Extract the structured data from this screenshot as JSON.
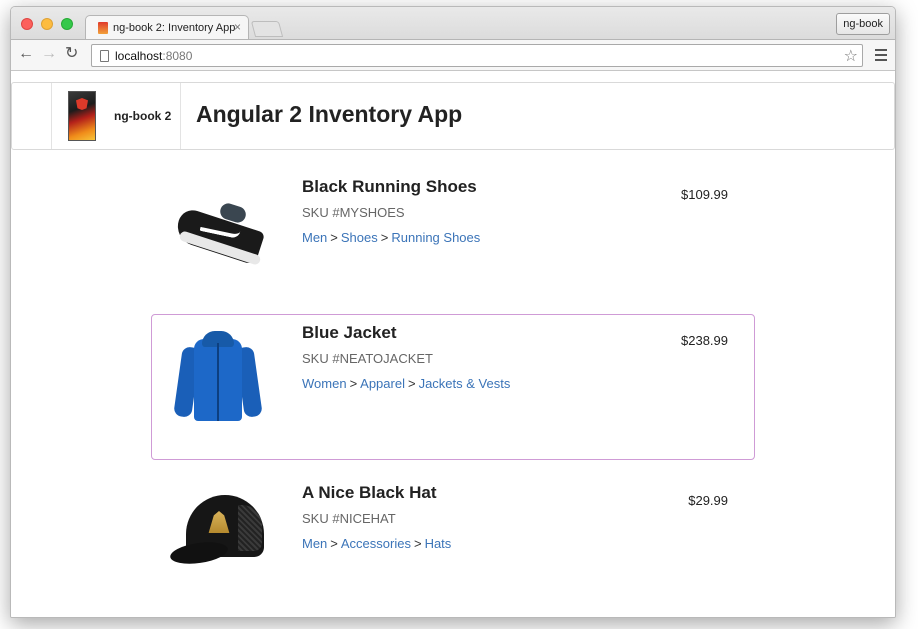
{
  "browser": {
    "tab_title": "ng-book 2: Inventory App",
    "tab_close": "×",
    "profile_button": "ng-book",
    "url_host": "localhost",
    "url_port": ":8080",
    "back_icon": "←",
    "forward_icon": "→",
    "reload_icon": "↻",
    "star_icon": "☆"
  },
  "header": {
    "brand": "ng-book 2",
    "title": "Angular 2 Inventory App"
  },
  "colors": {
    "link": "#3b74b8",
    "selected_border": "#cf9bd6"
  },
  "products": [
    {
      "name": "Black Running Shoes",
      "sku": "SKU #MYSHOES",
      "price": "$109.99",
      "image_icon": "shoe-image",
      "categories": [
        "Men",
        "Shoes",
        "Running Shoes"
      ],
      "separator": ">"
    },
    {
      "name": "Blue Jacket",
      "sku": "SKU #NEATOJACKET",
      "price": "$238.99",
      "image_icon": "jacket-image",
      "categories": [
        "Women",
        "Apparel",
        "Jackets & Vests"
      ],
      "separator": ">"
    },
    {
      "name": "A Nice Black Hat",
      "sku": "SKU #NICEHAT",
      "price": "$29.99",
      "image_icon": "hat-image",
      "categories": [
        "Men",
        "Accessories",
        "Hats"
      ],
      "separator": ">"
    }
  ]
}
